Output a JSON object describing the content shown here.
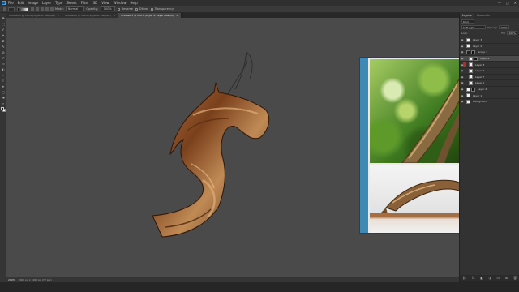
{
  "app": {
    "menus": [
      "File",
      "Edit",
      "Image",
      "Layer",
      "Type",
      "Select",
      "Filter",
      "3D",
      "View",
      "Window",
      "Help"
    ],
    "window_controls": [
      "—",
      "□",
      "✕"
    ]
  },
  "options_bar": {
    "mode_label": "Mode:",
    "mode_value": "Normal",
    "opacity_label": "Opacity:",
    "opacity_value": "100%",
    "reverse_label": "Reverse",
    "dither_label": "Dither",
    "transparency_label": "Transparency"
  },
  "tabs": [
    {
      "label": "Untitled-1 @ 100% (Layer 6, RGB/8#)",
      "close": "×",
      "active": false
    },
    {
      "label": "Untitled-2 @ 100% (Layer 6, RGB/8#)",
      "close": "×",
      "active": false
    },
    {
      "label": "Untitled-3 @ 200% (Layer 9, Layer Mask/8)",
      "close": "×",
      "active": true
    }
  ],
  "tools": [
    "✥",
    "⬚",
    "ℓ",
    "⌖",
    "⧄",
    "✎",
    "⊘",
    "✐",
    "▭",
    "◐",
    "✑",
    "T",
    "➤",
    "▢",
    "☚",
    "⌕"
  ],
  "colors": {
    "accent": "#31a8ff",
    "canvas_bg": "#4a4a4a",
    "panel_bg": "#323232",
    "layer_selected": "#4b4b4b",
    "wood_dark": "#4a2510",
    "wood_mid": "#8a4e24",
    "wood_light": "#c58a52",
    "ref_strip": "#3d8ab5"
  },
  "panels": {
    "tabs": [
      "Layers",
      "Channels"
    ],
    "kind_label": "Kind",
    "blend_mode": "Soft Light",
    "opacity_label": "Opacity:",
    "opacity_value": "100%",
    "lock_label": "Lock:",
    "fill_label": "Fill:",
    "fill_value": "100%",
    "layers": [
      {
        "name": "Layer 3",
        "kind": "pixel",
        "selected": false,
        "indent": false,
        "mask": false,
        "visible": true
      },
      {
        "name": "Layer 2",
        "kind": "pixel",
        "selected": false,
        "indent": false,
        "mask": false,
        "visible": true
      },
      {
        "name": "Group 1",
        "kind": "group",
        "selected": false,
        "indent": false,
        "mask": true,
        "visible": true
      },
      {
        "name": "Layer 9",
        "kind": "pixel",
        "selected": true,
        "indent": true,
        "mask": true,
        "visible": true
      },
      {
        "name": "Layer 8",
        "kind": "pixel",
        "selected": false,
        "indent": true,
        "mask": false,
        "visible": true,
        "flag": true
      },
      {
        "name": "Layer 6",
        "kind": "pixel",
        "selected": false,
        "indent": true,
        "mask": false,
        "visible": true
      },
      {
        "name": "Layer 7",
        "kind": "pixel",
        "selected": false,
        "indent": true,
        "mask": false,
        "visible": true
      },
      {
        "name": "Layer 5",
        "kind": "pixel",
        "selected": false,
        "indent": true,
        "mask": false,
        "visible": true
      },
      {
        "name": "Layer 4",
        "kind": "pixel",
        "selected": false,
        "indent": false,
        "mask": true,
        "visible": true
      },
      {
        "name": "Layer 1",
        "kind": "pixel",
        "selected": false,
        "indent": false,
        "mask": false,
        "visible": true
      },
      {
        "name": "Background",
        "kind": "background",
        "selected": false,
        "indent": false,
        "mask": false,
        "visible": true
      }
    ],
    "footer_icons": [
      "link-icon",
      "fx-icon",
      "mask-icon",
      "adjustment-icon",
      "folder-icon",
      "new-layer-icon",
      "trash-icon"
    ]
  },
  "status": {
    "zoom": "200%",
    "doc_info": "2000 px x 1000 px (72 ppi)"
  }
}
